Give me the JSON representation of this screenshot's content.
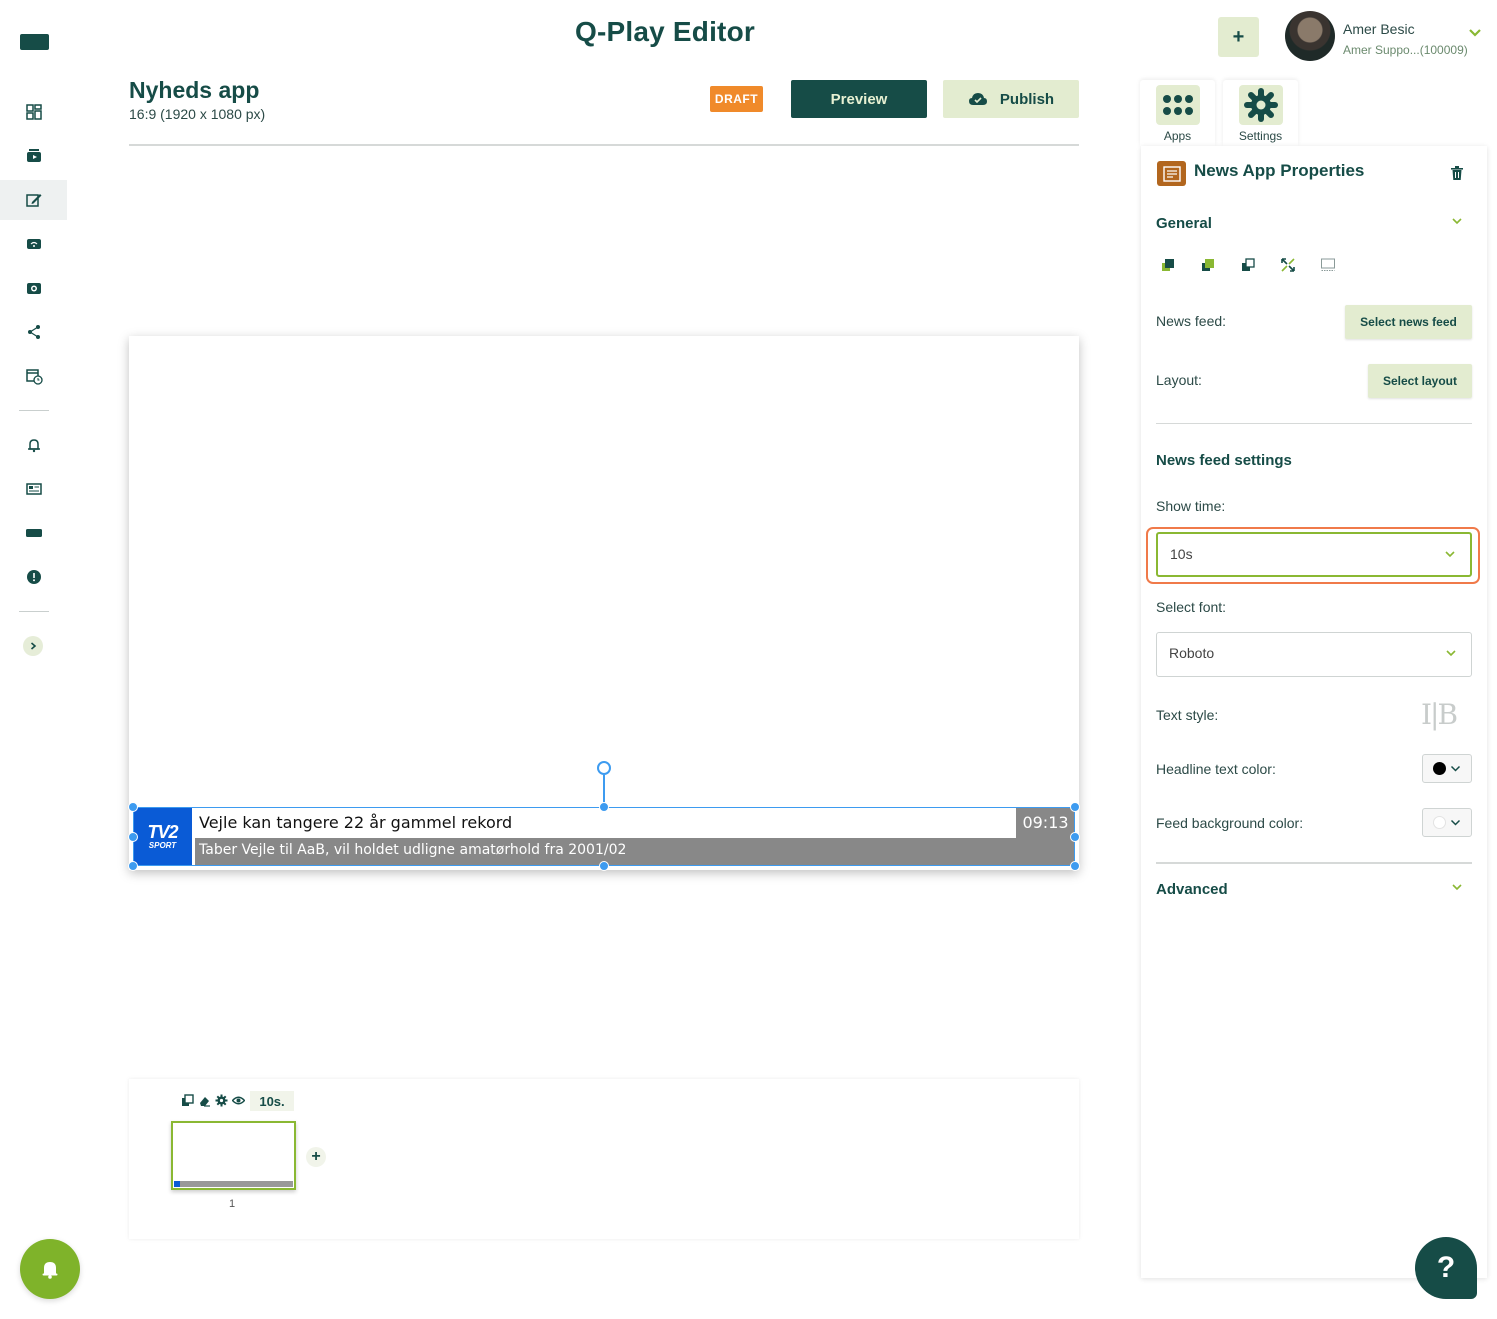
{
  "header": {
    "app_title": "Q-Play Editor",
    "add_label": "+",
    "user_name": "Amer Besic",
    "user_sub": "Amer Suppo...(100009)"
  },
  "project": {
    "title": "Nyheds app",
    "size": "16:9 (1920 x 1080 px)",
    "status": "DRAFT",
    "preview_label": "Preview",
    "publish_label": "Publish"
  },
  "ticker": {
    "logo_line1": "TV2",
    "logo_line2": "SPORT",
    "headline": "Vejle kan tangere 22 år gammel rekord",
    "subline": "Taber Vejle til AaB, vil holdet udligne amatørhold fra 2001/02",
    "time": "09:13"
  },
  "timeline": {
    "duration": "10s.",
    "slide_number": "1",
    "add_label": "+"
  },
  "tabs": [
    {
      "label": "Apps"
    },
    {
      "label": "Settings"
    }
  ],
  "panel": {
    "title": "News App Properties",
    "general_heading": "General",
    "news_feed_label": "News feed:",
    "select_news_feed": "Select news feed",
    "layout_label": "Layout:",
    "select_layout": "Select layout",
    "news_feed_settings_heading": "News feed settings",
    "show_time_label": "Show time:",
    "show_time_value": "10s",
    "select_font_label": "Select font:",
    "font_value": "Roboto",
    "text_style_label": "Text style:",
    "text_style_glyphs": "I|B",
    "headline_color_label": "Headline text color:",
    "feed_bg_color_label": "Feed background color:",
    "advanced_heading": "Advanced",
    "headline_color": "#000000",
    "feed_bg_color": "#ffffff"
  },
  "help_label": "?",
  "colors": {
    "brand_dark": "#164c47",
    "accent_green": "#8ab833",
    "draft_orange": "#f08a2a",
    "focus_orange": "#f07a4a"
  }
}
